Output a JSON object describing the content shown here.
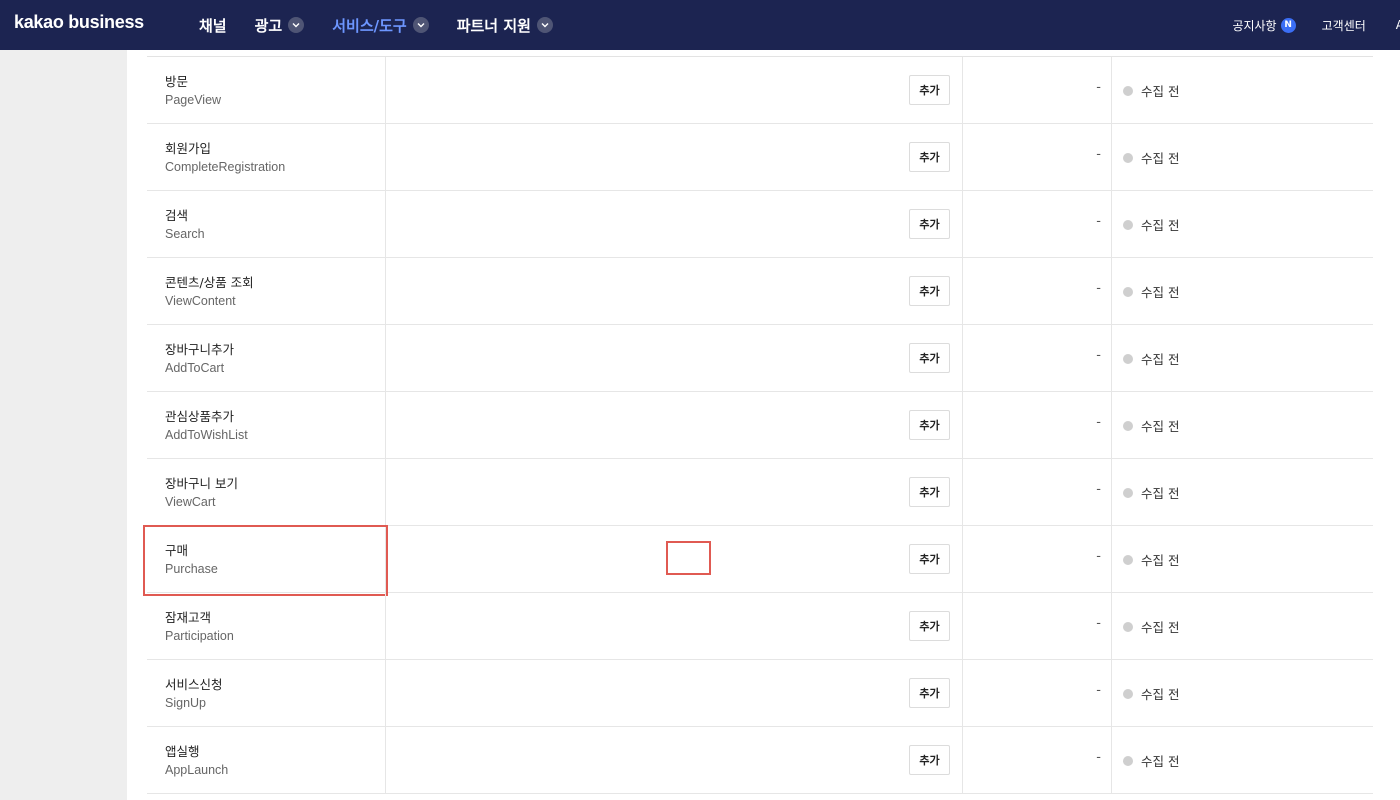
{
  "header": {
    "logo": "kakao business",
    "nav": [
      {
        "label": "채널",
        "has_dropdown": false,
        "active": false
      },
      {
        "label": "광고",
        "has_dropdown": true,
        "active": false
      },
      {
        "label": "서비스/도구",
        "has_dropdown": true,
        "active": true
      },
      {
        "label": "파트너 지원",
        "has_dropdown": true,
        "active": false
      }
    ],
    "notice": "공지사항",
    "notice_badge": "N",
    "support": "고객센터",
    "truncated": "A"
  },
  "events": [
    {
      "ko": "방문",
      "en": "PageView",
      "add": "추가",
      "count": "-",
      "status": "수집 전"
    },
    {
      "ko": "회원가입",
      "en": "CompleteRegistration",
      "add": "추가",
      "count": "-",
      "status": "수집 전"
    },
    {
      "ko": "검색",
      "en": "Search",
      "add": "추가",
      "count": "-",
      "status": "수집 전"
    },
    {
      "ko": "콘텐츠/상품 조회",
      "en": "ViewContent",
      "add": "추가",
      "count": "-",
      "status": "수집 전"
    },
    {
      "ko": "장바구니추가",
      "en": "AddToCart",
      "add": "추가",
      "count": "-",
      "status": "수집 전"
    },
    {
      "ko": "관심상품추가",
      "en": "AddToWishList",
      "add": "추가",
      "count": "-",
      "status": "수집 전"
    },
    {
      "ko": "장바구니 보기",
      "en": "ViewCart",
      "add": "추가",
      "count": "-",
      "status": "수집 전"
    },
    {
      "ko": "구매",
      "en": "Purchase",
      "add": "추가",
      "count": "-",
      "status": "수집 전",
      "highlighted": true
    },
    {
      "ko": "잠재고객",
      "en": "Participation",
      "add": "추가",
      "count": "-",
      "status": "수집 전"
    },
    {
      "ko": "서비스신청",
      "en": "SignUp",
      "add": "추가",
      "count": "-",
      "status": "수집 전"
    },
    {
      "ko": "앱실행",
      "en": "AppLaunch",
      "add": "추가",
      "count": "-",
      "status": "수집 전"
    }
  ],
  "colors": {
    "header_bg": "#1c2451",
    "nav_active": "#6d96ff",
    "badge": "#3b6ef5",
    "highlight": "#e05a52",
    "status_dot": "#cfcfcf"
  }
}
